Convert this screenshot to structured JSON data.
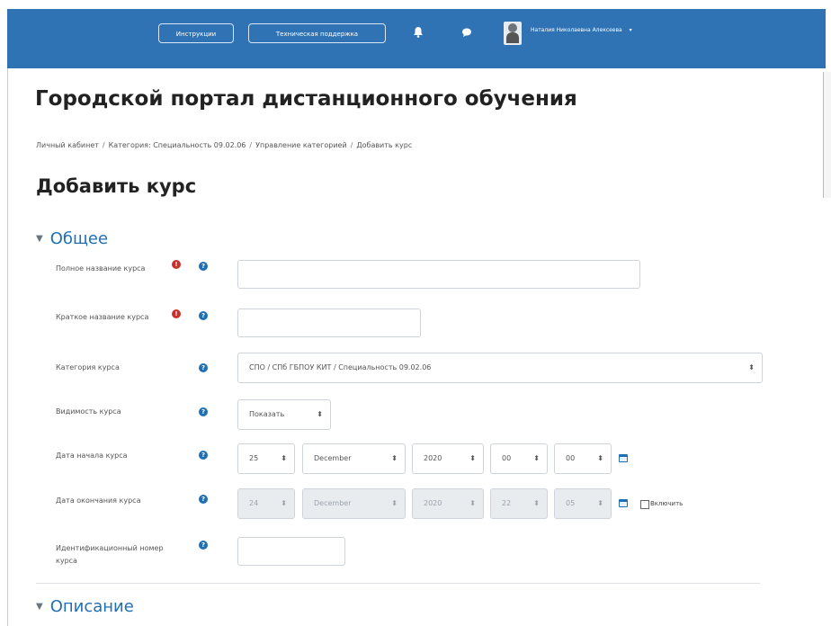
{
  "navbar": {
    "instructions_label": "Инструкции",
    "support_label": "Техническая поддержка",
    "user_name": "Наталия Николаевна Алексеева",
    "user_menu_caret": "▾"
  },
  "site_title": "Городской портал дистанционного обучения",
  "breadcrumb": [
    "Личный кабинет",
    "Категория: Специальность 09.02.06",
    "Управление категорией",
    "Добавить курс"
  ],
  "page_title": "Добавить курс",
  "sections": {
    "general": "Общее",
    "description": "Описание"
  },
  "form": {
    "fullname_label": "Полное название курса",
    "shortname_label": "Краткое название курса",
    "category_label": "Категория курса",
    "category_value": "СПО / СПб ГБПОУ КИТ / Специальность 09.02.06",
    "visibility_label": "Видимость курса",
    "visibility_value": "Показать",
    "startdate_label": "Дата начала курса",
    "startdate": {
      "day": "25",
      "month": "December",
      "year": "2020",
      "hour": "00",
      "minute": "00"
    },
    "enddate_label": "Дата окончания курса",
    "enddate": {
      "day": "24",
      "month": "December",
      "year": "2020",
      "hour": "22",
      "minute": "05"
    },
    "enable_label": "Включить",
    "idnumber_label": "Идентификационный номер курса"
  },
  "icons": {
    "required": "!",
    "help": "?",
    "select_arrow": "⬍",
    "bell": "🔔",
    "chat": "●"
  },
  "colors": {
    "navbar": "#2f73b5",
    "accent": "#1f6fb4",
    "required": "#c9302c"
  }
}
